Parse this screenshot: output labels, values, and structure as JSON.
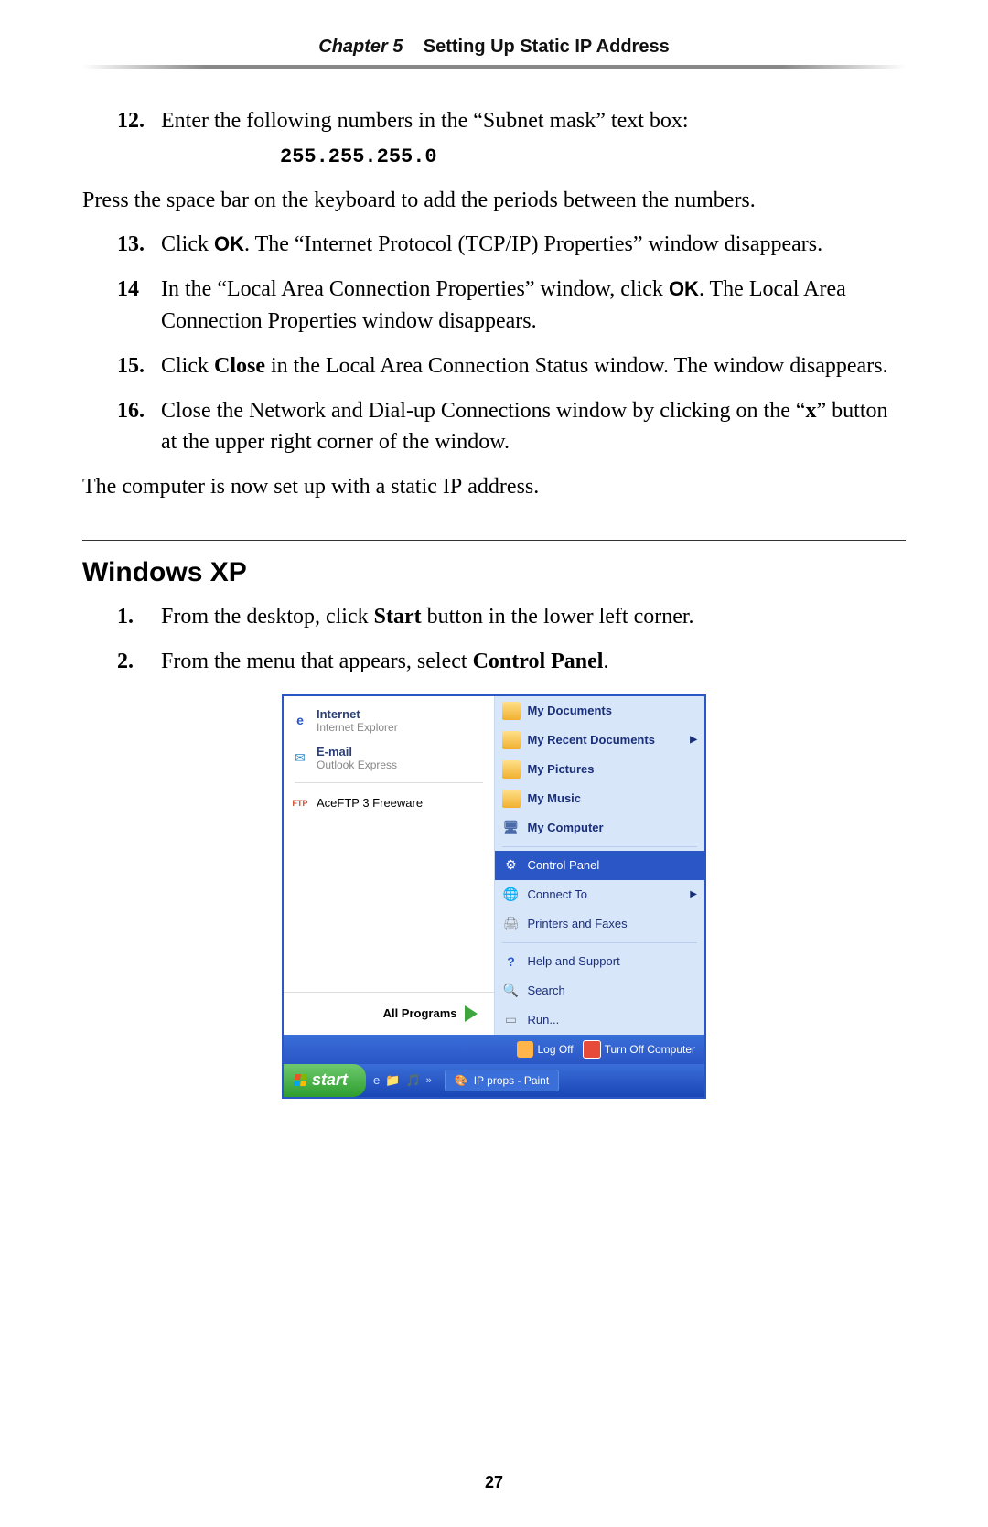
{
  "header": {
    "chapter_label": "Chapter 5",
    "chapter_title": "Setting Up Static IP Address"
  },
  "steps_a": [
    {
      "num": "12.",
      "html": "Enter the following numbers in the “Subnet mask” text box:"
    }
  ],
  "subnet_mono": "255.255.255.0",
  "para1": "Press the space bar on the keyboard to add the periods between the numbers.",
  "step13_num": "13.",
  "step13_pre": "Click ",
  "step13_ok": "OK",
  "step13_post": ". The “Internet Protocol (",
  "step13_tcpip": "TCP/IP",
  "step13_post2": ") Properties” window disappears.",
  "step14_num": "14",
  "step14_pre": "In the “Local Area Connection Properties” window, click ",
  "step14_ok": "OK",
  "step14_post": ". The Local Area Connection Properties window disappears.",
  "step15_num": "15.",
  "step15_pre": "Click ",
  "step15_close": "Close",
  "step15_post": " in the Local Area Connection Status window. The window disappears.",
  "step16_num": "16.",
  "step16_pre": "Close the Network and Dial-up Connections window by clicking on the “",
  "step16_x": "x",
  "step16_post": "” button at the upper right corner of the window.",
  "para2_a": "The computer is now set up with a static ",
  "para2_ip": "IP",
  "para2_b": " address.",
  "section_title": "Windows XP",
  "xp_step1_num": "1.",
  "xp_step1_a": "From the desktop, click ",
  "xp_step1_start": "Start",
  "xp_step1_b": " button in the lower left corner.",
  "xp_step2_num": "2.",
  "xp_step2_a": "From the menu that appears, select ",
  "xp_step2_cp": "Control Panel",
  "xp_step2_b": ".",
  "startmenu": {
    "left": {
      "internet": {
        "title": "Internet",
        "sub": "Internet Explorer"
      },
      "email": {
        "title": "E-mail",
        "sub": "Outlook Express"
      },
      "ace": {
        "title": "AceFTP 3 Freeware"
      },
      "all_programs": "All Programs"
    },
    "right": {
      "docs": "My Documents",
      "recent": "My Recent Documents",
      "pics": "My Pictures",
      "music": "My Music",
      "computer": "My Computer",
      "cpanel": "Control Panel",
      "connect": "Connect To",
      "printers": "Printers and Faxes",
      "help": "Help and Support",
      "search": "Search",
      "run": "Run..."
    },
    "logoff": "Log Off",
    "turnoff": "Turn Off Computer",
    "start_label": "start",
    "task_item": "IP props - Paint",
    "chevrons": "»"
  },
  "page_number": "27"
}
